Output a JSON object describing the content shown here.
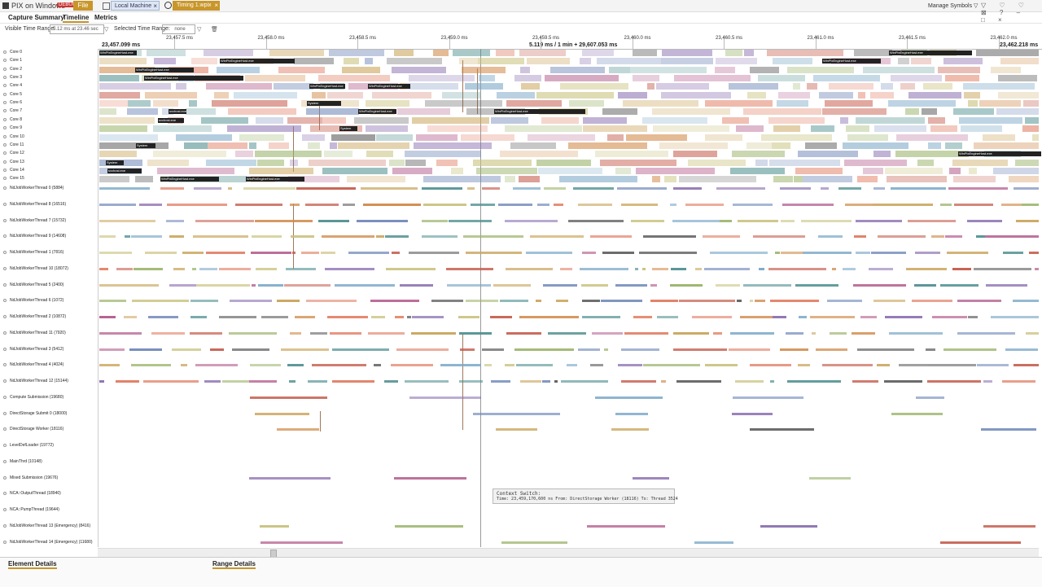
{
  "window": {
    "app_title": "PIX on Windows",
    "badge": "DEBUG",
    "file_label": "File",
    "connection_tab": "Local Machine",
    "capture_tab": "Timing 1.wpix",
    "close_glyph": "×",
    "manage_symbols": "Manage Symbols",
    "dropdown_glyph": "▽",
    "toolbar_glyphs": "▽ ♡ ♡ ⊠ ?  – □ ×"
  },
  "menu": {
    "capture_summary": "Capture Summary",
    "timeline": "Timeline",
    "metrics": "Metrics"
  },
  "range": {
    "visible_label": "Visible Time Range:",
    "visible_value": "5.12 ms at 23.46 sec",
    "selected_label": "Selected Time Range:",
    "selected_value": "none",
    "filter_glyph": "▽",
    "trash_glyph": "🗑"
  },
  "ruler": {
    "start": "23,457.099 ms",
    "end": "23,462.218 ms",
    "center": "5.119 ms / 1 min + 29,607.053 ms",
    "ticks": [
      "23,457.5 ms",
      "23,458.0 ms",
      "23,458.5 ms",
      "23,459.0 ms",
      "23,459.5 ms",
      "23,460.0 ms",
      "23,460.5 ms",
      "23,461.0 ms",
      "23,461.5 ms",
      "23,462.0 ms"
    ]
  },
  "cores": [
    "Core 0",
    "Core 1",
    "Core 2",
    "Core 3",
    "Core 4",
    "Core 5",
    "Core 6",
    "Core 7",
    "Core 8",
    "Core 9",
    "Core 10",
    "Core 11",
    "Core 12",
    "Core 13",
    "Core 14",
    "Core 15"
  ],
  "threads": [
    "NdJobWorkerThread 0 (5884)",
    "NdJobWorkerThread 8 (16516)",
    "NdJobWorkerThread 7 (15732)",
    "NdJobWorkerThread 9 (14608)",
    "NdJobWorkerThread 1 (7816)",
    "NdJobWorkerThread 10 (18072)",
    "NdJobWorkerThread 5 (2400)",
    "NdJobWorkerThread 6 (1072)",
    "NdJobWorkerThread 2 (10872)",
    "NdJobWorkerThread 11 (7920)",
    "NdJobWorkerThread 3 (5412)",
    "NdJobWorkerThread 4 (4024)",
    "NdJobWorkerThread 12 (15144)",
    "Compute Submission (19680)",
    "DirectStorage Submit 0 (18000)",
    "DirectStorage Worker (18116)",
    "LevelDefLoader (19772)",
    "MainThrd (10148)",
    "Mixed Submission (19676)",
    "NCA::OutputThread (18940)",
    "NCA::PumpThread (19644)",
    "NdJobWorkerThread 13 (Emergency) (8416)",
    "NdJobWorkerThread 14 (Emergency) (11680)"
  ],
  "process_labels": {
    "engine_host": "WinPixEngineHost.exe",
    "system": "System",
    "svchost": "svchost.exe"
  },
  "tooltip": {
    "title": "Context Switch:",
    "body": "Time: 23,459,170,600 ns   From: DirectStorage Worker (18116)  To: Thread 3524"
  },
  "bottom": {
    "element_details": "Element Details",
    "range_details": "Range Details"
  },
  "colors": {
    "accent": "#c8962a",
    "flow": "#a0785a",
    "palette": [
      "#c9a45a",
      "#6f87b8",
      "#9ab36a",
      "#c45b4b",
      "#8a6fb0",
      "#d08a4a",
      "#4f8f8f",
      "#b35d8c",
      "#7aa7c7",
      "#c7c07a",
      "#5a5a5a",
      "#e07a5f"
    ]
  }
}
